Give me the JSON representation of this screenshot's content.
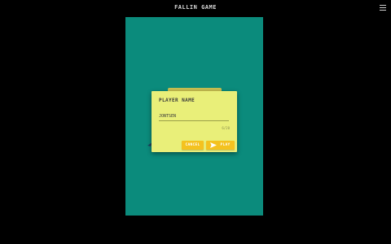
{
  "header": {
    "app_title": "FALLIN GAME",
    "menu_icon": "hamburger-menu-icon"
  },
  "dialog": {
    "title": "PLAYER NAME",
    "input_value": "JONTSEN",
    "input_placeholder": "",
    "char_counter": "6/20",
    "cancel_label": "CANCEL",
    "start_label": "PLAY",
    "start_icon": "send-arrow-icon"
  },
  "colors": {
    "background": "#000000",
    "game_area": "#0b8b7c",
    "dialog": "#e9ef79",
    "button": "#f4c21f"
  }
}
